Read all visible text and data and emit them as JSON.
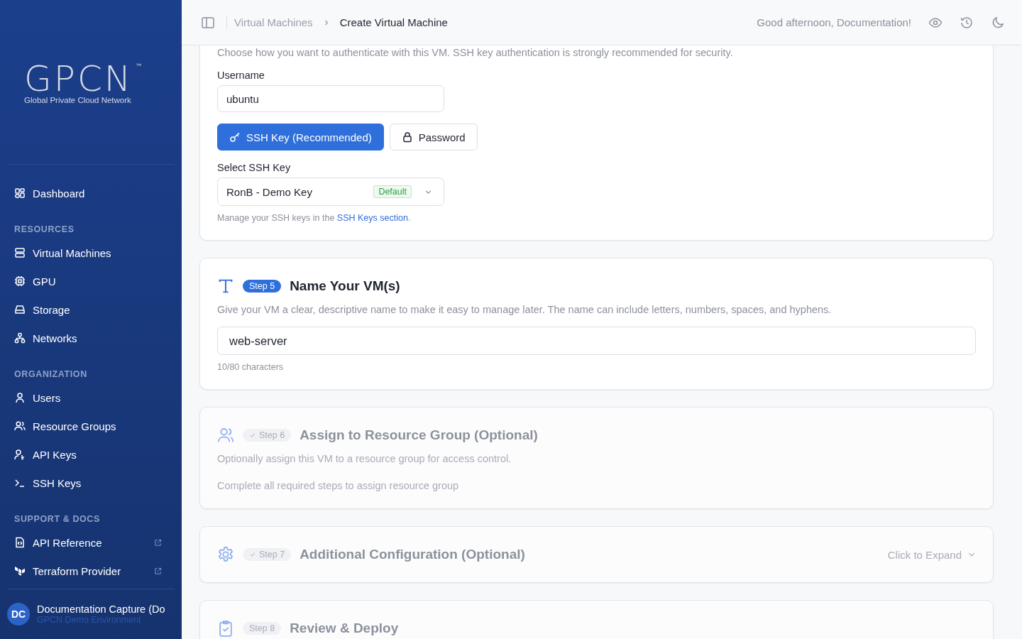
{
  "sidebar": {
    "logo": {
      "mark": "GPCN",
      "tm": "™",
      "tagline": "Global Private Cloud Network"
    },
    "top_items": [
      {
        "label": "Dashboard"
      }
    ],
    "sections": [
      {
        "title": "RESOURCES",
        "items": [
          {
            "label": "Virtual Machines",
            "external": false
          },
          {
            "label": "GPU",
            "external": false
          },
          {
            "label": "Storage",
            "external": false
          },
          {
            "label": "Networks",
            "external": false
          }
        ]
      },
      {
        "title": "ORGANIZATION",
        "items": [
          {
            "label": "Users",
            "external": false
          },
          {
            "label": "Resource Groups",
            "external": false
          },
          {
            "label": "API Keys",
            "external": false
          },
          {
            "label": "SSH Keys",
            "external": false
          }
        ]
      },
      {
        "title": "SUPPORT & DOCS",
        "items": [
          {
            "label": "API Reference",
            "external": true
          },
          {
            "label": "Terraform Provider",
            "external": true
          }
        ]
      }
    ],
    "user": {
      "initials": "DC",
      "name": "Documentation Capture (Do",
      "org": "GPCN Demo Environment"
    }
  },
  "header": {
    "breadcrumbs": [
      {
        "label": "Virtual Machines",
        "current": false
      },
      {
        "label": "Create Virtual Machine",
        "current": true
      }
    ],
    "greeting": "Good afternoon, Documentation!"
  },
  "auth_card": {
    "description": "Choose how you want to authenticate with this VM. SSH key authentication is strongly recommended for security.",
    "username_label": "Username",
    "username": "ubuntu",
    "methods": [
      {
        "label": "SSH Key (Recommended)",
        "selected": true
      },
      {
        "label": "Password",
        "selected": false
      }
    ],
    "key_label": "Select SSH Key",
    "key_value": "RonB - Demo Key",
    "key_badge": "Default",
    "help": "Manage your SSH keys in the ",
    "help_link": "SSH Keys section",
    "help_end": "."
  },
  "steps": [
    {
      "step": "Step 5",
      "title": "Name Your VM(s)",
      "active": true,
      "completed": false,
      "description": "Give your VM a clear, descriptive name to make it easy to manage later. The name can include letters, numbers, spaces, and hyphens.",
      "value": "web-server",
      "counter": "10/80 characters"
    },
    {
      "step": "Step 6",
      "title": "Assign to Resource Group (Optional)",
      "active": false,
      "completed": true,
      "description": "Optionally assign this VM to a resource group for access control.",
      "note": "Complete all required steps to assign resource group"
    },
    {
      "step": "Step 7",
      "title": "Additional Configuration (Optional)",
      "active": false,
      "completed": true,
      "expand": "Click to Expand"
    },
    {
      "step": "Step 8",
      "title": "Review & Deploy",
      "active": false,
      "completed": false
    }
  ]
}
